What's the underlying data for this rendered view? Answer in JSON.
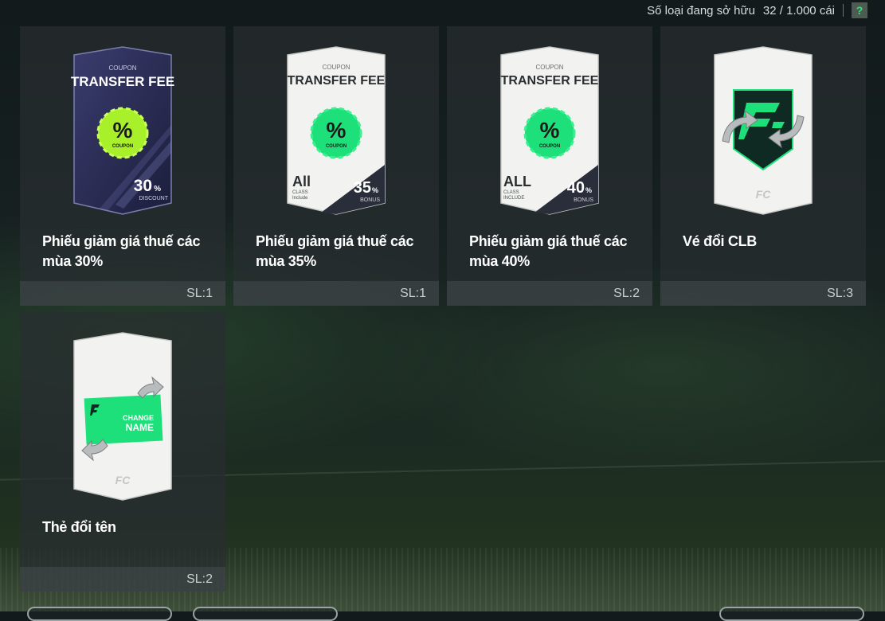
{
  "header": {
    "owned_label": "Số loại đang sở hữu",
    "owned_value": "32 / 1.000 cái",
    "help_label": "?"
  },
  "items": [
    {
      "name": "Phiếu giảm giá thuế các mùa 30%",
      "qty": "SL:1",
      "art": {
        "coupon": "COUPON",
        "title": "TRANSFER FEE",
        "badge": "%",
        "badge_sub": "COUPON",
        "value": "30",
        "unit": "%",
        "value_sub": "DISCOUNT"
      }
    },
    {
      "name": "Phiếu giảm giá thuế các mùa 35%",
      "qty": "SL:1",
      "art": {
        "coupon": "COUPON",
        "title": "TRANSFER FEE",
        "badge": "%",
        "badge_sub": "COUPON",
        "all": "All",
        "all_sub1": "CLASS",
        "all_sub2": "Include",
        "value": "35",
        "unit": "%",
        "value_sub": "BONUS"
      }
    },
    {
      "name": "Phiếu giảm giá thuế các mùa 40%",
      "qty": "SL:2",
      "art": {
        "coupon": "COUPON",
        "title": "TRANSFER FEE",
        "badge": "%",
        "badge_sub": "COUPON",
        "all": "ALL",
        "all_sub1": "CLASS",
        "all_sub2": "INCLUDE",
        "value": "40",
        "unit": "%",
        "value_sub": "BONUS"
      }
    },
    {
      "name": "Vé đổi CLB",
      "qty": "SL:3",
      "art": {
        "logo": "FC"
      }
    },
    {
      "name": "Thẻ đổi tên",
      "qty": "SL:2",
      "art": {
        "logo": "FC",
        "change1": "CHANGE",
        "change2": "NAME"
      }
    }
  ],
  "colors": {
    "accent_green": "#35e27a",
    "coupon_lime": "#a8f02a",
    "card_panel": "#2c3234",
    "dark_ticket": "#2c2f55",
    "text": "#ffffff",
    "qty_text": "#c9cdcd"
  },
  "icons": [
    "help-icon",
    "percent-badge-icon",
    "fc-logo-icon",
    "swap-arrows-icon"
  ]
}
